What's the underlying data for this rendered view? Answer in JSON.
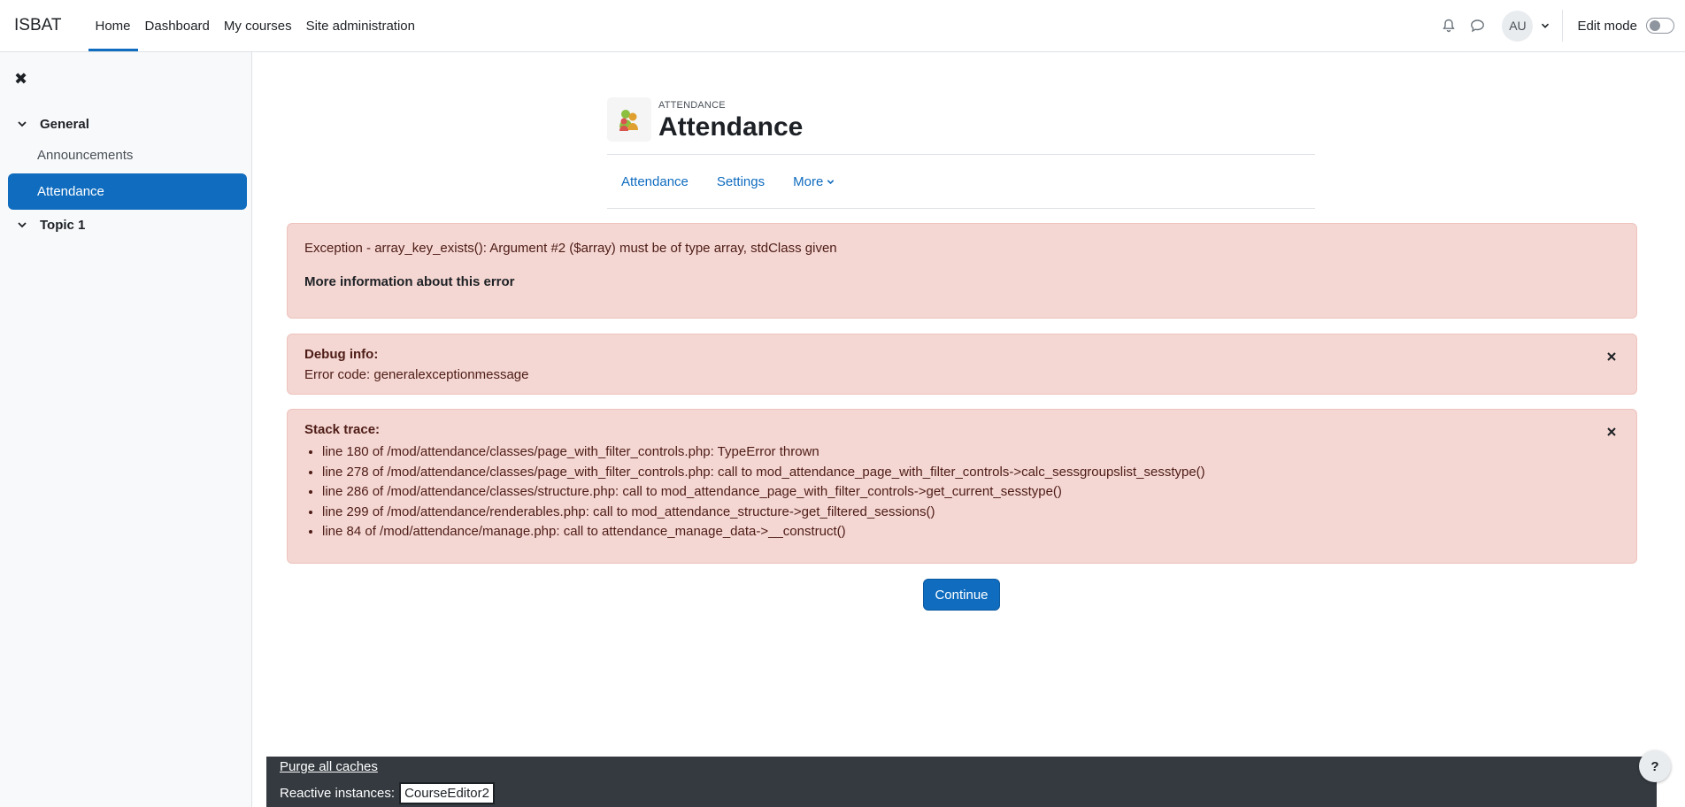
{
  "navbar": {
    "brand": "ISBAT",
    "links": [
      "Home",
      "Dashboard",
      "My courses",
      "Site administration"
    ],
    "active": "Home",
    "avatar_initials": "AU",
    "edit_mode_label": "Edit mode",
    "edit_mode_on": false,
    "icons": [
      "bell-icon",
      "chat-icon",
      "chevron-down-icon"
    ]
  },
  "drawer": {
    "close_icon": "close-icon",
    "sections": [
      {
        "title": "General",
        "items": [
          "Announcements",
          "Attendance"
        ]
      },
      {
        "title": "Topic 1",
        "items": []
      }
    ],
    "active_item": "Attendance"
  },
  "header": {
    "pretitle": "ATTENDANCE",
    "title": "Attendance"
  },
  "secondary_nav": {
    "links": [
      "Attendance",
      "Settings",
      "More"
    ]
  },
  "errors": {
    "exception_message": "Exception - array_key_exists(): Argument #2 ($array) must be of type array, stdClass given",
    "more_info": "More information about this error",
    "debug_title": "Debug info:",
    "error_code": "Error code: generalexceptionmessage",
    "stack_title": "Stack trace:",
    "stack": [
      "line 180 of /mod/attendance/classes/page_with_filter_controls.php: TypeError thrown",
      "line 278 of /mod/attendance/classes/page_with_filter_controls.php: call to mod_attendance_page_with_filter_controls->calc_sessgroupslist_sesstype()",
      "line 286 of /mod/attendance/classes/structure.php: call to mod_attendance_page_with_filter_controls->get_current_sesstype()",
      "line 299 of /mod/attendance/renderables.php: call to mod_attendance_structure->get_filtered_sessions()",
      "line 84 of /mod/attendance/manage.php: call to attendance_manage_data->__construct()"
    ]
  },
  "continue_label": "Continue",
  "footer": {
    "purge_label": "Purge all caches",
    "reactive_label": "Reactive instances:",
    "reactive_button": "CourseEditor2"
  },
  "help_label": "?"
}
